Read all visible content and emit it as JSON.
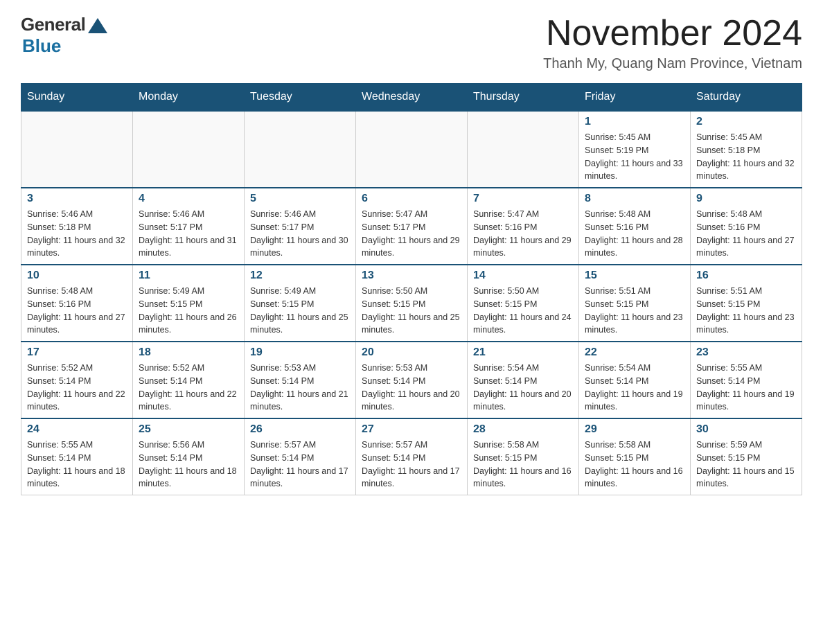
{
  "logo": {
    "general": "General",
    "blue": "Blue"
  },
  "title": "November 2024",
  "subtitle": "Thanh My, Quang Nam Province, Vietnam",
  "days_of_week": [
    "Sunday",
    "Monday",
    "Tuesday",
    "Wednesday",
    "Thursday",
    "Friday",
    "Saturday"
  ],
  "weeks": [
    [
      {
        "day": "",
        "sunrise": "",
        "sunset": "",
        "daylight": ""
      },
      {
        "day": "",
        "sunrise": "",
        "sunset": "",
        "daylight": ""
      },
      {
        "day": "",
        "sunrise": "",
        "sunset": "",
        "daylight": ""
      },
      {
        "day": "",
        "sunrise": "",
        "sunset": "",
        "daylight": ""
      },
      {
        "day": "",
        "sunrise": "",
        "sunset": "",
        "daylight": ""
      },
      {
        "day": "1",
        "sunrise": "Sunrise: 5:45 AM",
        "sunset": "Sunset: 5:19 PM",
        "daylight": "Daylight: 11 hours and 33 minutes."
      },
      {
        "day": "2",
        "sunrise": "Sunrise: 5:45 AM",
        "sunset": "Sunset: 5:18 PM",
        "daylight": "Daylight: 11 hours and 32 minutes."
      }
    ],
    [
      {
        "day": "3",
        "sunrise": "Sunrise: 5:46 AM",
        "sunset": "Sunset: 5:18 PM",
        "daylight": "Daylight: 11 hours and 32 minutes."
      },
      {
        "day": "4",
        "sunrise": "Sunrise: 5:46 AM",
        "sunset": "Sunset: 5:17 PM",
        "daylight": "Daylight: 11 hours and 31 minutes."
      },
      {
        "day": "5",
        "sunrise": "Sunrise: 5:46 AM",
        "sunset": "Sunset: 5:17 PM",
        "daylight": "Daylight: 11 hours and 30 minutes."
      },
      {
        "day": "6",
        "sunrise": "Sunrise: 5:47 AM",
        "sunset": "Sunset: 5:17 PM",
        "daylight": "Daylight: 11 hours and 29 minutes."
      },
      {
        "day": "7",
        "sunrise": "Sunrise: 5:47 AM",
        "sunset": "Sunset: 5:16 PM",
        "daylight": "Daylight: 11 hours and 29 minutes."
      },
      {
        "day": "8",
        "sunrise": "Sunrise: 5:48 AM",
        "sunset": "Sunset: 5:16 PM",
        "daylight": "Daylight: 11 hours and 28 minutes."
      },
      {
        "day": "9",
        "sunrise": "Sunrise: 5:48 AM",
        "sunset": "Sunset: 5:16 PM",
        "daylight": "Daylight: 11 hours and 27 minutes."
      }
    ],
    [
      {
        "day": "10",
        "sunrise": "Sunrise: 5:48 AM",
        "sunset": "Sunset: 5:16 PM",
        "daylight": "Daylight: 11 hours and 27 minutes."
      },
      {
        "day": "11",
        "sunrise": "Sunrise: 5:49 AM",
        "sunset": "Sunset: 5:15 PM",
        "daylight": "Daylight: 11 hours and 26 minutes."
      },
      {
        "day": "12",
        "sunrise": "Sunrise: 5:49 AM",
        "sunset": "Sunset: 5:15 PM",
        "daylight": "Daylight: 11 hours and 25 minutes."
      },
      {
        "day": "13",
        "sunrise": "Sunrise: 5:50 AM",
        "sunset": "Sunset: 5:15 PM",
        "daylight": "Daylight: 11 hours and 25 minutes."
      },
      {
        "day": "14",
        "sunrise": "Sunrise: 5:50 AM",
        "sunset": "Sunset: 5:15 PM",
        "daylight": "Daylight: 11 hours and 24 minutes."
      },
      {
        "day": "15",
        "sunrise": "Sunrise: 5:51 AM",
        "sunset": "Sunset: 5:15 PM",
        "daylight": "Daylight: 11 hours and 23 minutes."
      },
      {
        "day": "16",
        "sunrise": "Sunrise: 5:51 AM",
        "sunset": "Sunset: 5:15 PM",
        "daylight": "Daylight: 11 hours and 23 minutes."
      }
    ],
    [
      {
        "day": "17",
        "sunrise": "Sunrise: 5:52 AM",
        "sunset": "Sunset: 5:14 PM",
        "daylight": "Daylight: 11 hours and 22 minutes."
      },
      {
        "day": "18",
        "sunrise": "Sunrise: 5:52 AM",
        "sunset": "Sunset: 5:14 PM",
        "daylight": "Daylight: 11 hours and 22 minutes."
      },
      {
        "day": "19",
        "sunrise": "Sunrise: 5:53 AM",
        "sunset": "Sunset: 5:14 PM",
        "daylight": "Daylight: 11 hours and 21 minutes."
      },
      {
        "day": "20",
        "sunrise": "Sunrise: 5:53 AM",
        "sunset": "Sunset: 5:14 PM",
        "daylight": "Daylight: 11 hours and 20 minutes."
      },
      {
        "day": "21",
        "sunrise": "Sunrise: 5:54 AM",
        "sunset": "Sunset: 5:14 PM",
        "daylight": "Daylight: 11 hours and 20 minutes."
      },
      {
        "day": "22",
        "sunrise": "Sunrise: 5:54 AM",
        "sunset": "Sunset: 5:14 PM",
        "daylight": "Daylight: 11 hours and 19 minutes."
      },
      {
        "day": "23",
        "sunrise": "Sunrise: 5:55 AM",
        "sunset": "Sunset: 5:14 PM",
        "daylight": "Daylight: 11 hours and 19 minutes."
      }
    ],
    [
      {
        "day": "24",
        "sunrise": "Sunrise: 5:55 AM",
        "sunset": "Sunset: 5:14 PM",
        "daylight": "Daylight: 11 hours and 18 minutes."
      },
      {
        "day": "25",
        "sunrise": "Sunrise: 5:56 AM",
        "sunset": "Sunset: 5:14 PM",
        "daylight": "Daylight: 11 hours and 18 minutes."
      },
      {
        "day": "26",
        "sunrise": "Sunrise: 5:57 AM",
        "sunset": "Sunset: 5:14 PM",
        "daylight": "Daylight: 11 hours and 17 minutes."
      },
      {
        "day": "27",
        "sunrise": "Sunrise: 5:57 AM",
        "sunset": "Sunset: 5:14 PM",
        "daylight": "Daylight: 11 hours and 17 minutes."
      },
      {
        "day": "28",
        "sunrise": "Sunrise: 5:58 AM",
        "sunset": "Sunset: 5:15 PM",
        "daylight": "Daylight: 11 hours and 16 minutes."
      },
      {
        "day": "29",
        "sunrise": "Sunrise: 5:58 AM",
        "sunset": "Sunset: 5:15 PM",
        "daylight": "Daylight: 11 hours and 16 minutes."
      },
      {
        "day": "30",
        "sunrise": "Sunrise: 5:59 AM",
        "sunset": "Sunset: 5:15 PM",
        "daylight": "Daylight: 11 hours and 15 minutes."
      }
    ]
  ]
}
